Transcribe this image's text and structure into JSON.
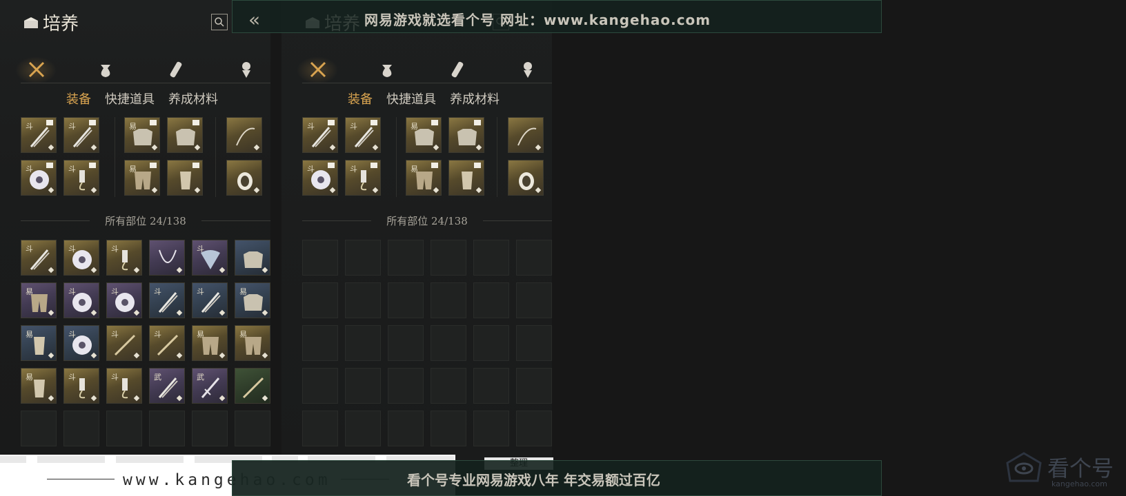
{
  "top_banner": {
    "text": "网易游戏就选看个号    网址：www.kangehao.com"
  },
  "bottom_banner": {
    "text": "看个号专业网易游戏八年    年交易额过百亿",
    "website": "www.kangehao.com",
    "tidy_label": "整理"
  },
  "logo": {
    "name": "看个号",
    "sub": "kangehao.com"
  },
  "panels": [
    {
      "title": "培养",
      "tabs": [
        "装备",
        "快捷道具",
        "养成材料"
      ],
      "active_tab": 0,
      "section_label": "所有部位 24/138"
    },
    {
      "title": "培养",
      "tabs": [
        "装备",
        "快捷道具",
        "养成材料"
      ],
      "active_tab": 0,
      "section_label": "所有部位 24/138"
    }
  ],
  "equipped": [
    {
      "glyph": "斗",
      "rarity": "gold",
      "icon": "dual-blade-icon",
      "tag": true
    },
    {
      "glyph": "斗",
      "rarity": "gold",
      "icon": "long-blade-icon",
      "tag": true
    },
    {
      "glyph": "易",
      "rarity": "gold",
      "icon": "shoulder-armor-icon",
      "tag": true
    },
    {
      "glyph": "",
      "rarity": "gold",
      "icon": "chest-armor-icon",
      "tag": true
    },
    {
      "glyph": "",
      "rarity": "gold",
      "icon": "bow-icon",
      "tag": false
    },
    {
      "glyph": "斗",
      "rarity": "gold",
      "icon": "jade-disc-icon",
      "tag": true
    },
    {
      "glyph": "斗",
      "rarity": "gold",
      "icon": "pendant-icon",
      "tag": true
    },
    {
      "glyph": "易",
      "rarity": "gold",
      "icon": "leg-armor-icon",
      "tag": true
    },
    {
      "glyph": "",
      "rarity": "gold",
      "icon": "gauntlet-icon",
      "tag": true
    },
    {
      "glyph": "",
      "rarity": "gold",
      "icon": "ring-icon",
      "tag": false
    }
  ],
  "inventory": [
    {
      "glyph": "斗",
      "rarity": "gold",
      "icon": "dual-blade-icon"
    },
    {
      "glyph": "斗",
      "rarity": "gold",
      "icon": "jade-disc-icon"
    },
    {
      "glyph": "斗",
      "rarity": "gold",
      "icon": "pendant-icon"
    },
    {
      "glyph": "",
      "rarity": "purple",
      "icon": "necklace-icon"
    },
    {
      "glyph": "斗",
      "rarity": "purple",
      "icon": "fan-icon"
    },
    {
      "glyph": "",
      "rarity": "blue",
      "icon": "chest-armor-icon"
    },
    {
      "glyph": "易",
      "rarity": "purple",
      "icon": "leg-armor-icon"
    },
    {
      "glyph": "斗",
      "rarity": "purple",
      "icon": "jade-disc-icon"
    },
    {
      "glyph": "斗",
      "rarity": "purple",
      "icon": "jade-disc-icon"
    },
    {
      "glyph": "斗",
      "rarity": "blue",
      "icon": "long-blade-icon"
    },
    {
      "glyph": "斗",
      "rarity": "blue",
      "icon": "long-blade-icon"
    },
    {
      "glyph": "易",
      "rarity": "blue",
      "icon": "shoulder-armor-icon"
    },
    {
      "glyph": "易",
      "rarity": "blue",
      "icon": "gauntlet-icon"
    },
    {
      "glyph": "斗",
      "rarity": "blue",
      "icon": "jade-disc-icon"
    },
    {
      "glyph": "斗",
      "rarity": "gold",
      "icon": "spear-icon"
    },
    {
      "glyph": "斗",
      "rarity": "gold",
      "icon": "spear-icon"
    },
    {
      "glyph": "易",
      "rarity": "gold",
      "icon": "leg-armor-icon"
    },
    {
      "glyph": "易",
      "rarity": "gold",
      "icon": "leg-armor-icon"
    },
    {
      "glyph": "易",
      "rarity": "gold",
      "icon": "bracer-icon"
    },
    {
      "glyph": "斗",
      "rarity": "gold",
      "icon": "pendant-icon"
    },
    {
      "glyph": "斗",
      "rarity": "gold",
      "icon": "pendant-icon"
    },
    {
      "glyph": "武",
      "rarity": "purple",
      "icon": "long-blade-icon"
    },
    {
      "glyph": "武",
      "rarity": "purple",
      "icon": "sword-icon"
    },
    {
      "glyph": "",
      "rarity": "green",
      "icon": "spear-icon"
    }
  ],
  "colors": {
    "accent": "#d9a450",
    "banner_border": "#2d4a3d"
  }
}
